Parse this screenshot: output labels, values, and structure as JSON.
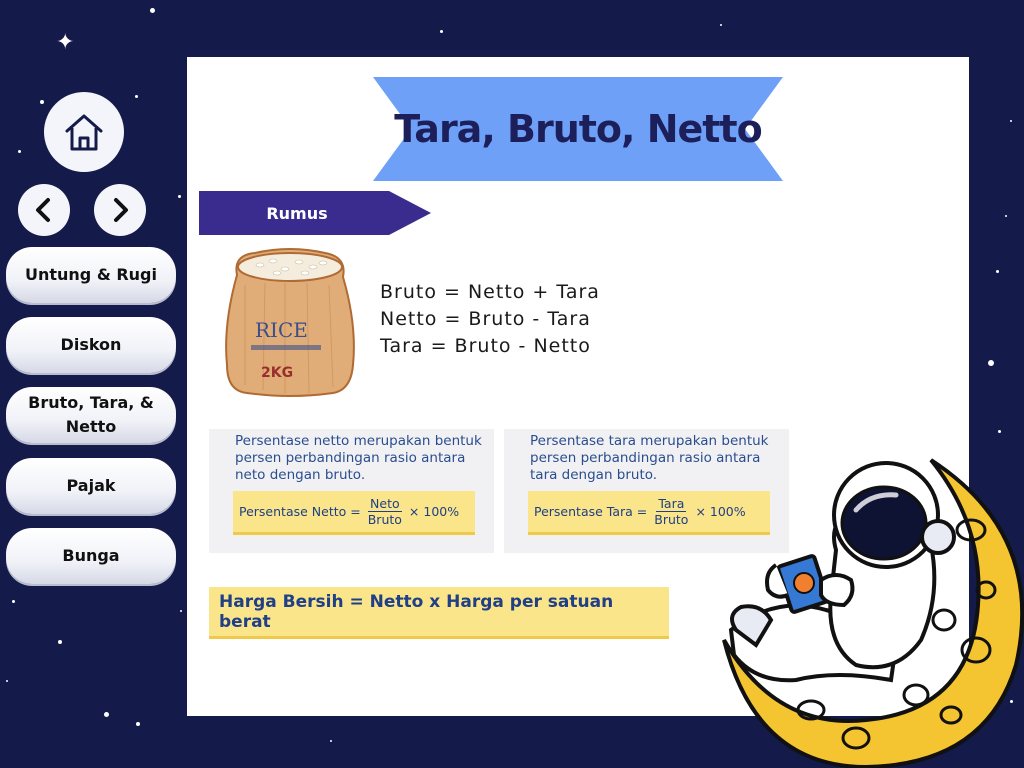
{
  "nav": {
    "home_icon": "home-icon",
    "prev_icon": "chevron-left-icon",
    "next_icon": "chevron-right-icon",
    "menu": [
      {
        "label": "Untung & Rugi"
      },
      {
        "label": "Diskon"
      },
      {
        "label": "Bruto, Tara, & Netto"
      },
      {
        "label": "Pajak"
      },
      {
        "label": "Bunga"
      }
    ]
  },
  "page": {
    "title": "Tara, Bruto, Netto",
    "section_tag": "Rumus",
    "sack_text": "RICE",
    "sack_weight": "2KG",
    "formulas": [
      "Bruto = Netto + Tara",
      "Netto = Bruto - Tara",
      "Tara = Bruto - Netto"
    ],
    "netto_box": {
      "description": "Persentase netto merupakan bentuk persen perbandingan rasio antara neto dengan bruto.",
      "label": "Persentase Netto =",
      "numerator": "Neto",
      "denominator": "Bruto",
      "suffix": "× 100%"
    },
    "tara_box": {
      "description": "Persentase tara merupakan bentuk persen perbandingan rasio antara tara dengan bruto.",
      "label": "Persentase Tara =",
      "numerator": "Tara",
      "denominator": "Bruto",
      "suffix": "× 100%"
    },
    "harga_bersih": "Harga Bersih = Netto x Harga per satuan berat"
  },
  "colors": {
    "background": "#141a4a",
    "ribbon": "#6ea0f7",
    "tag": "#3a2c8f",
    "highlight": "#fbe58a",
    "moon": "#f5c531"
  }
}
